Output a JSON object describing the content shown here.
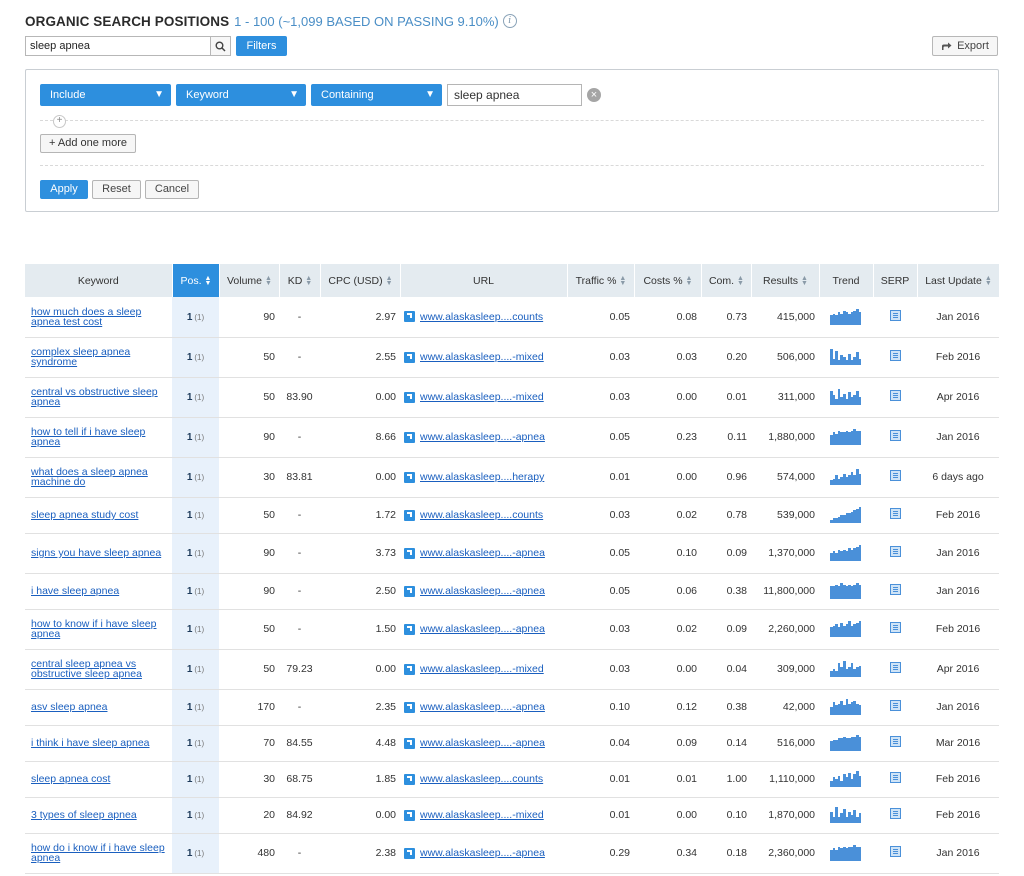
{
  "header": {
    "title": "ORGANIC SEARCH POSITIONS",
    "subtitle": "1 - 100 (~1,099 BASED ON PASSING 9.10%)",
    "info_icon": "info-icon"
  },
  "search": {
    "value": "sleep apnea",
    "icon": "search-icon",
    "filters_label": "Filters"
  },
  "export_label": "Export",
  "filter_panel": {
    "include_label": "Include",
    "field_label": "Keyword",
    "operator_label": "Containing",
    "value": "sleep apnea",
    "add_more_label": "+ Add one more",
    "apply_label": "Apply",
    "reset_label": "Reset",
    "cancel_label": "Cancel"
  },
  "colors": {
    "accent": "#2d8fde",
    "link": "#1a5fbf",
    "header_bg": "#e4ebf0"
  },
  "table": {
    "columns": [
      "Keyword",
      "Pos.",
      "Volume",
      "KD",
      "CPC (USD)",
      "URL",
      "Traffic %",
      "Costs %",
      "Com.",
      "Results",
      "Trend",
      "SERP",
      "Last Update"
    ],
    "rows": [
      {
        "keyword": "how much does a sleep apnea test cost",
        "pos": "1",
        "prev": "(1)",
        "volume": "90",
        "kd": "-",
        "cpc": "2.97",
        "url": "www.alaskasleep....counts",
        "traffic": "0.05",
        "costs": "0.08",
        "com": "0.73",
        "results": "415,000",
        "update": "Jan 2016",
        "trend": [
          0.6,
          0.7,
          0.6,
          0.8,
          0.7,
          0.9,
          0.8,
          0.7,
          0.8,
          0.9,
          1.0,
          0.8
        ]
      },
      {
        "keyword": "complex sleep apnea syndrome",
        "pos": "1",
        "prev": "(1)",
        "volume": "50",
        "kd": "-",
        "cpc": "2.55",
        "url": "www.alaskasleep....-mixed",
        "traffic": "0.03",
        "costs": "0.03",
        "com": "0.20",
        "results": "506,000",
        "update": "Feb 2016",
        "trend": [
          1.0,
          0.4,
          0.9,
          0.3,
          0.6,
          0.5,
          0.3,
          0.7,
          0.3,
          0.5,
          0.8,
          0.4
        ]
      },
      {
        "keyword": "central vs obstructive sleep apnea",
        "pos": "1",
        "prev": "(1)",
        "volume": "50",
        "kd": "83.90",
        "cpc": "0.00",
        "url": "www.alaskasleep....-mixed",
        "traffic": "0.03",
        "costs": "0.00",
        "com": "0.01",
        "results": "311,000",
        "update": "Apr 2016",
        "trend": [
          0.9,
          0.6,
          0.4,
          1.0,
          0.5,
          0.7,
          0.4,
          0.8,
          0.5,
          0.6,
          0.9,
          0.5
        ]
      },
      {
        "keyword": "how to tell if i have sleep apnea",
        "pos": "1",
        "prev": "(1)",
        "volume": "90",
        "kd": "-",
        "cpc": "8.66",
        "url": "www.alaskasleep....-apnea",
        "traffic": "0.05",
        "costs": "0.23",
        "com": "0.11",
        "results": "1,880,000",
        "update": "Jan 2016",
        "trend": [
          0.6,
          0.8,
          0.7,
          0.9,
          0.8,
          0.8,
          0.9,
          0.8,
          0.9,
          1.0,
          0.9,
          0.9
        ]
      },
      {
        "keyword": "what does a sleep apnea machine do",
        "pos": "1",
        "prev": "(1)",
        "volume": "30",
        "kd": "83.81",
        "cpc": "0.00",
        "url": "www.alaskasleep....herapy",
        "traffic": "0.01",
        "costs": "0.00",
        "com": "0.96",
        "results": "574,000",
        "update": "6 days ago",
        "trend": [
          0.3,
          0.4,
          0.6,
          0.4,
          0.5,
          0.7,
          0.5,
          0.6,
          0.8,
          0.6,
          1.0,
          0.7
        ]
      },
      {
        "keyword": "sleep apnea study cost",
        "pos": "1",
        "prev": "(1)",
        "volume": "50",
        "kd": "-",
        "cpc": "1.72",
        "url": "www.alaskasleep....counts",
        "traffic": "0.03",
        "costs": "0.02",
        "com": "0.78",
        "results": "539,000",
        "update": "Feb 2016",
        "trend": [
          0.2,
          0.3,
          0.3,
          0.4,
          0.5,
          0.5,
          0.6,
          0.6,
          0.7,
          0.8,
          0.9,
          1.0
        ]
      },
      {
        "keyword": "signs you have sleep apnea",
        "pos": "1",
        "prev": "(1)",
        "volume": "90",
        "kd": "-",
        "cpc": "3.73",
        "url": "www.alaskasleep....-apnea",
        "traffic": "0.05",
        "costs": "0.10",
        "com": "0.09",
        "results": "1,370,000",
        "update": "Jan 2016",
        "trend": [
          0.5,
          0.6,
          0.5,
          0.7,
          0.6,
          0.7,
          0.6,
          0.8,
          0.7,
          0.8,
          0.9,
          1.0
        ]
      },
      {
        "keyword": "i have sleep apnea",
        "pos": "1",
        "prev": "(1)",
        "volume": "90",
        "kd": "-",
        "cpc": "2.50",
        "url": "www.alaskasleep....-apnea",
        "traffic": "0.05",
        "costs": "0.06",
        "com": "0.38",
        "results": "11,800,000",
        "update": "Jan 2016",
        "trend": [
          0.8,
          0.8,
          0.9,
          0.8,
          1.0,
          0.9,
          0.8,
          0.9,
          0.8,
          0.9,
          1.0,
          0.9
        ]
      },
      {
        "keyword": "how to know if i have sleep apnea",
        "pos": "1",
        "prev": "(1)",
        "volume": "50",
        "kd": "-",
        "cpc": "1.50",
        "url": "www.alaskasleep....-apnea",
        "traffic": "0.03",
        "costs": "0.02",
        "com": "0.09",
        "results": "2,260,000",
        "update": "Feb 2016",
        "trend": [
          0.6,
          0.7,
          0.8,
          0.6,
          0.9,
          0.7,
          0.8,
          1.0,
          0.7,
          0.8,
          0.9,
          1.0
        ]
      },
      {
        "keyword": "central sleep apnea vs obstructive sleep apnea",
        "pos": "1",
        "prev": "(1)",
        "volume": "50",
        "kd": "79.23",
        "cpc": "0.00",
        "url": "www.alaskasleep....-mixed",
        "traffic": "0.03",
        "costs": "0.00",
        "com": "0.04",
        "results": "309,000",
        "update": "Apr 2016",
        "trend": [
          0.4,
          0.5,
          0.4,
          0.9,
          0.6,
          1.0,
          0.5,
          0.6,
          0.9,
          0.5,
          0.6,
          0.7
        ]
      },
      {
        "keyword": "asv sleep apnea",
        "pos": "1",
        "prev": "(1)",
        "volume": "170",
        "kd": "-",
        "cpc": "2.35",
        "url": "www.alaskasleep....-apnea",
        "traffic": "0.10",
        "costs": "0.12",
        "com": "0.38",
        "results": "42,000",
        "update": "Jan 2016",
        "trend": [
          0.5,
          0.8,
          0.6,
          0.7,
          0.9,
          0.6,
          1.0,
          0.7,
          0.8,
          0.9,
          0.7,
          0.6
        ]
      },
      {
        "keyword": "i think i have sleep apnea",
        "pos": "1",
        "prev": "(1)",
        "volume": "70",
        "kd": "84.55",
        "cpc": "4.48",
        "url": "www.alaskasleep....-apnea",
        "traffic": "0.04",
        "costs": "0.09",
        "com": "0.14",
        "results": "516,000",
        "update": "Mar 2016",
        "trend": [
          0.6,
          0.7,
          0.7,
          0.8,
          0.8,
          0.9,
          0.8,
          0.8,
          0.9,
          0.9,
          1.0,
          0.9
        ]
      },
      {
        "keyword": "sleep apnea cost",
        "pos": "1",
        "prev": "(1)",
        "volume": "30",
        "kd": "68.75",
        "cpc": "1.85",
        "url": "www.alaskasleep....counts",
        "traffic": "0.01",
        "costs": "0.01",
        "com": "1.00",
        "results": "1,110,000",
        "update": "Feb 2016",
        "trend": [
          0.4,
          0.6,
          0.5,
          0.7,
          0.4,
          0.8,
          0.6,
          0.9,
          0.5,
          0.8,
          1.0,
          0.7
        ]
      },
      {
        "keyword": "3 types of sleep apnea",
        "pos": "1",
        "prev": "(1)",
        "volume": "20",
        "kd": "84.92",
        "cpc": "0.00",
        "url": "www.alaskasleep....-mixed",
        "traffic": "0.01",
        "costs": "0.00",
        "com": "0.10",
        "results": "1,870,000",
        "update": "Feb 2016",
        "trend": [
          0.7,
          0.4,
          1.0,
          0.4,
          0.6,
          0.9,
          0.4,
          0.7,
          0.5,
          0.8,
          0.4,
          0.6
        ]
      },
      {
        "keyword": "how do i know if i have sleep apnea",
        "pos": "1",
        "prev": "(1)",
        "volume": "480",
        "kd": "-",
        "cpc": "2.38",
        "url": "www.alaskasleep....-apnea",
        "traffic": "0.29",
        "costs": "0.34",
        "com": "0.18",
        "results": "2,360,000",
        "update": "Jan 2016",
        "trend": [
          0.7,
          0.8,
          0.7,
          0.9,
          0.8,
          0.9,
          0.8,
          0.9,
          0.9,
          1.0,
          0.9,
          0.9
        ]
      }
    ]
  }
}
